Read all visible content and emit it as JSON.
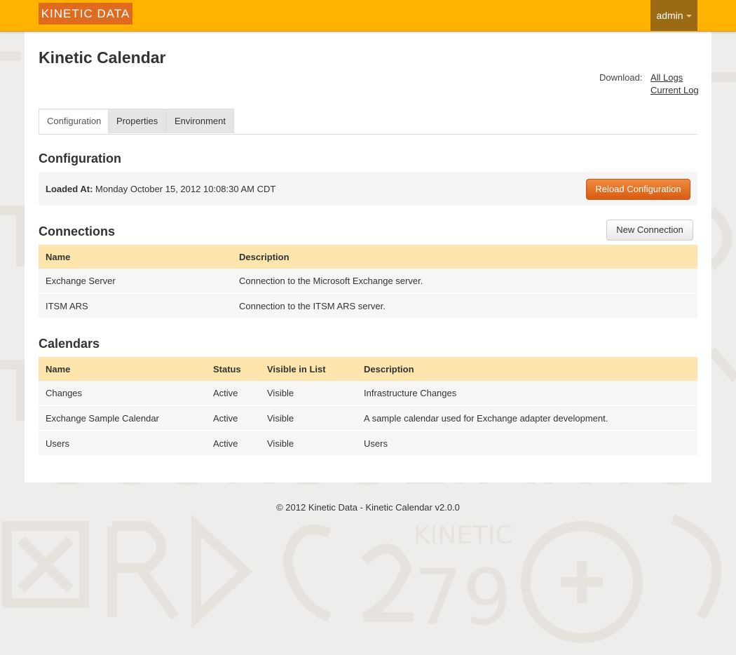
{
  "header": {
    "logo_text": "KINETIC DATA",
    "user_label": "admin"
  },
  "page": {
    "title": "Kinetic Calendar",
    "download_label": "Download:",
    "download_links": [
      "All Logs",
      "Current Log"
    ]
  },
  "tabs": [
    {
      "label": "Configuration",
      "active": true
    },
    {
      "label": "Properties",
      "active": false
    },
    {
      "label": "Environment",
      "active": false
    }
  ],
  "configuration": {
    "heading": "Configuration",
    "loaded_label": "Loaded At:",
    "loaded_value": "Monday October 15, 2012 10:08:30 AM CDT",
    "reload_button": "Reload Configuration"
  },
  "connections": {
    "heading": "Connections",
    "new_button": "New Connection",
    "columns": [
      "Name",
      "Description"
    ],
    "rows": [
      {
        "name": "Exchange Server",
        "description": "Connection to the Microsoft Exchange server."
      },
      {
        "name": "ITSM ARS",
        "description": "Connection to the ITSM ARS server."
      }
    ]
  },
  "calendars": {
    "heading": "Calendars",
    "columns": [
      "Name",
      "Status",
      "Visible in List",
      "Description"
    ],
    "rows": [
      {
        "name": "Changes",
        "status": "Active",
        "visible": "Visible",
        "description": "Infrastructure Changes"
      },
      {
        "name": "Exchange Sample Calendar",
        "status": "Active",
        "visible": "Visible",
        "description": "A sample calendar used for Exchange adapter development."
      },
      {
        "name": "Users",
        "status": "Active",
        "visible": "Visible",
        "description": "Users"
      }
    ]
  },
  "footer": {
    "text": "© 2012 Kinetic Data - Kinetic Calendar v2.0.0"
  },
  "colors": {
    "topbar": "#ffb300",
    "logo_bg": "#e06b1f",
    "user_menu_bg": "#9a6b13",
    "table_header": "#fde5ad",
    "status_active": "#4fc24f",
    "reload_button": "#e0681d"
  }
}
